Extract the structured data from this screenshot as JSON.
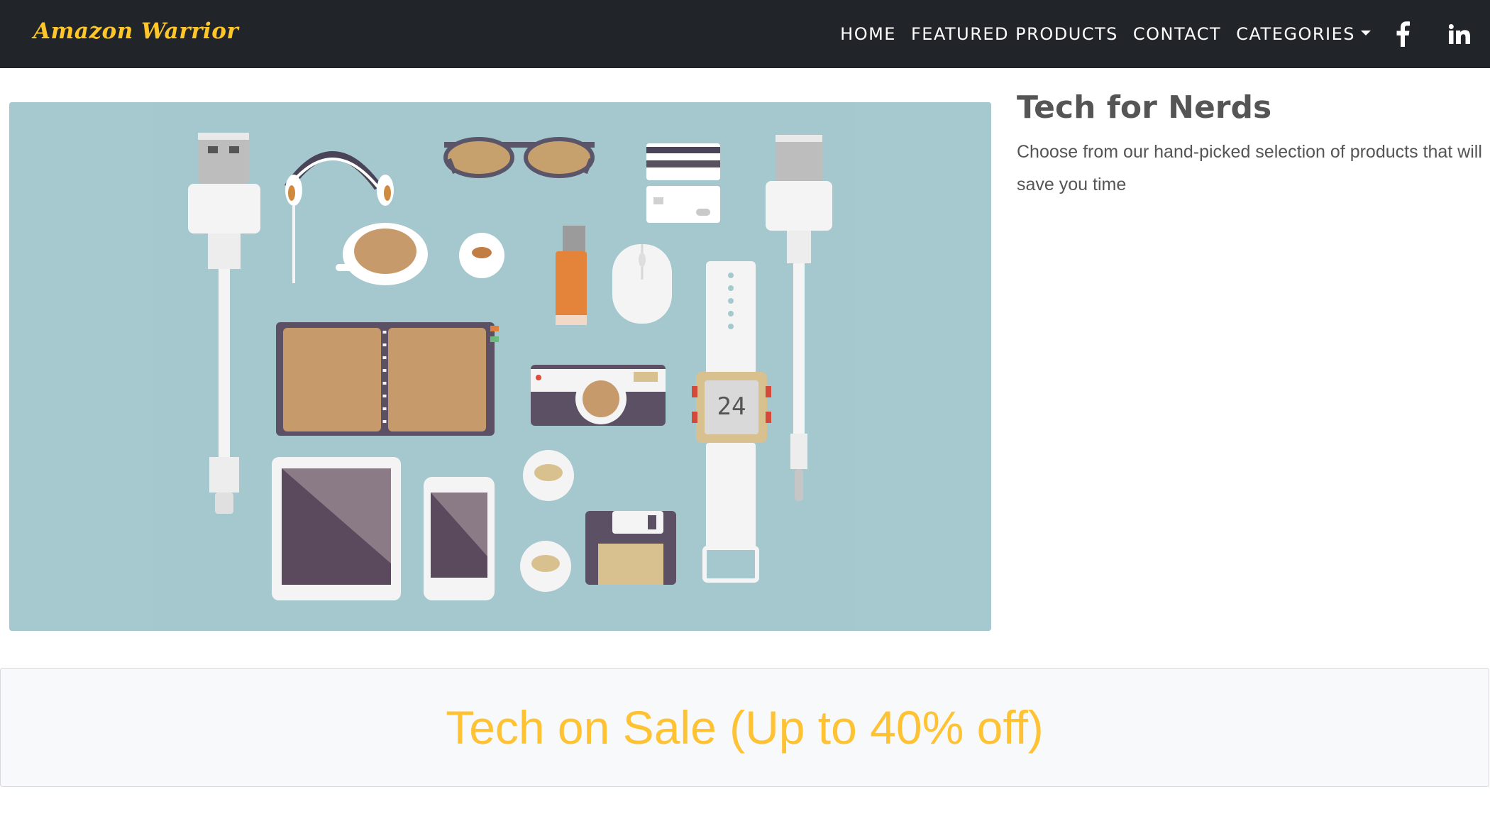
{
  "navbar": {
    "brand": "Amazon Warrior",
    "links": [
      "HOME",
      "FEATURED PRODUCTS",
      "CONTACT",
      "CATEGORIES"
    ],
    "social": [
      "facebook-icon",
      "linkedin-icon"
    ]
  },
  "hero": {
    "image_name": "flat-tech-gadgets-illustration",
    "watch_display": "24",
    "title": "Tech for Nerds",
    "description": "Choose from our hand-picked selection of products that will save you time"
  },
  "banner": {
    "text": "Tech on Sale (Up to 40% off)"
  },
  "colors": {
    "navbar_bg": "#212529",
    "brand": "#ffc629",
    "accent": "#ffc233",
    "hero_bg": "#a6c8cf",
    "text": "#555555"
  }
}
